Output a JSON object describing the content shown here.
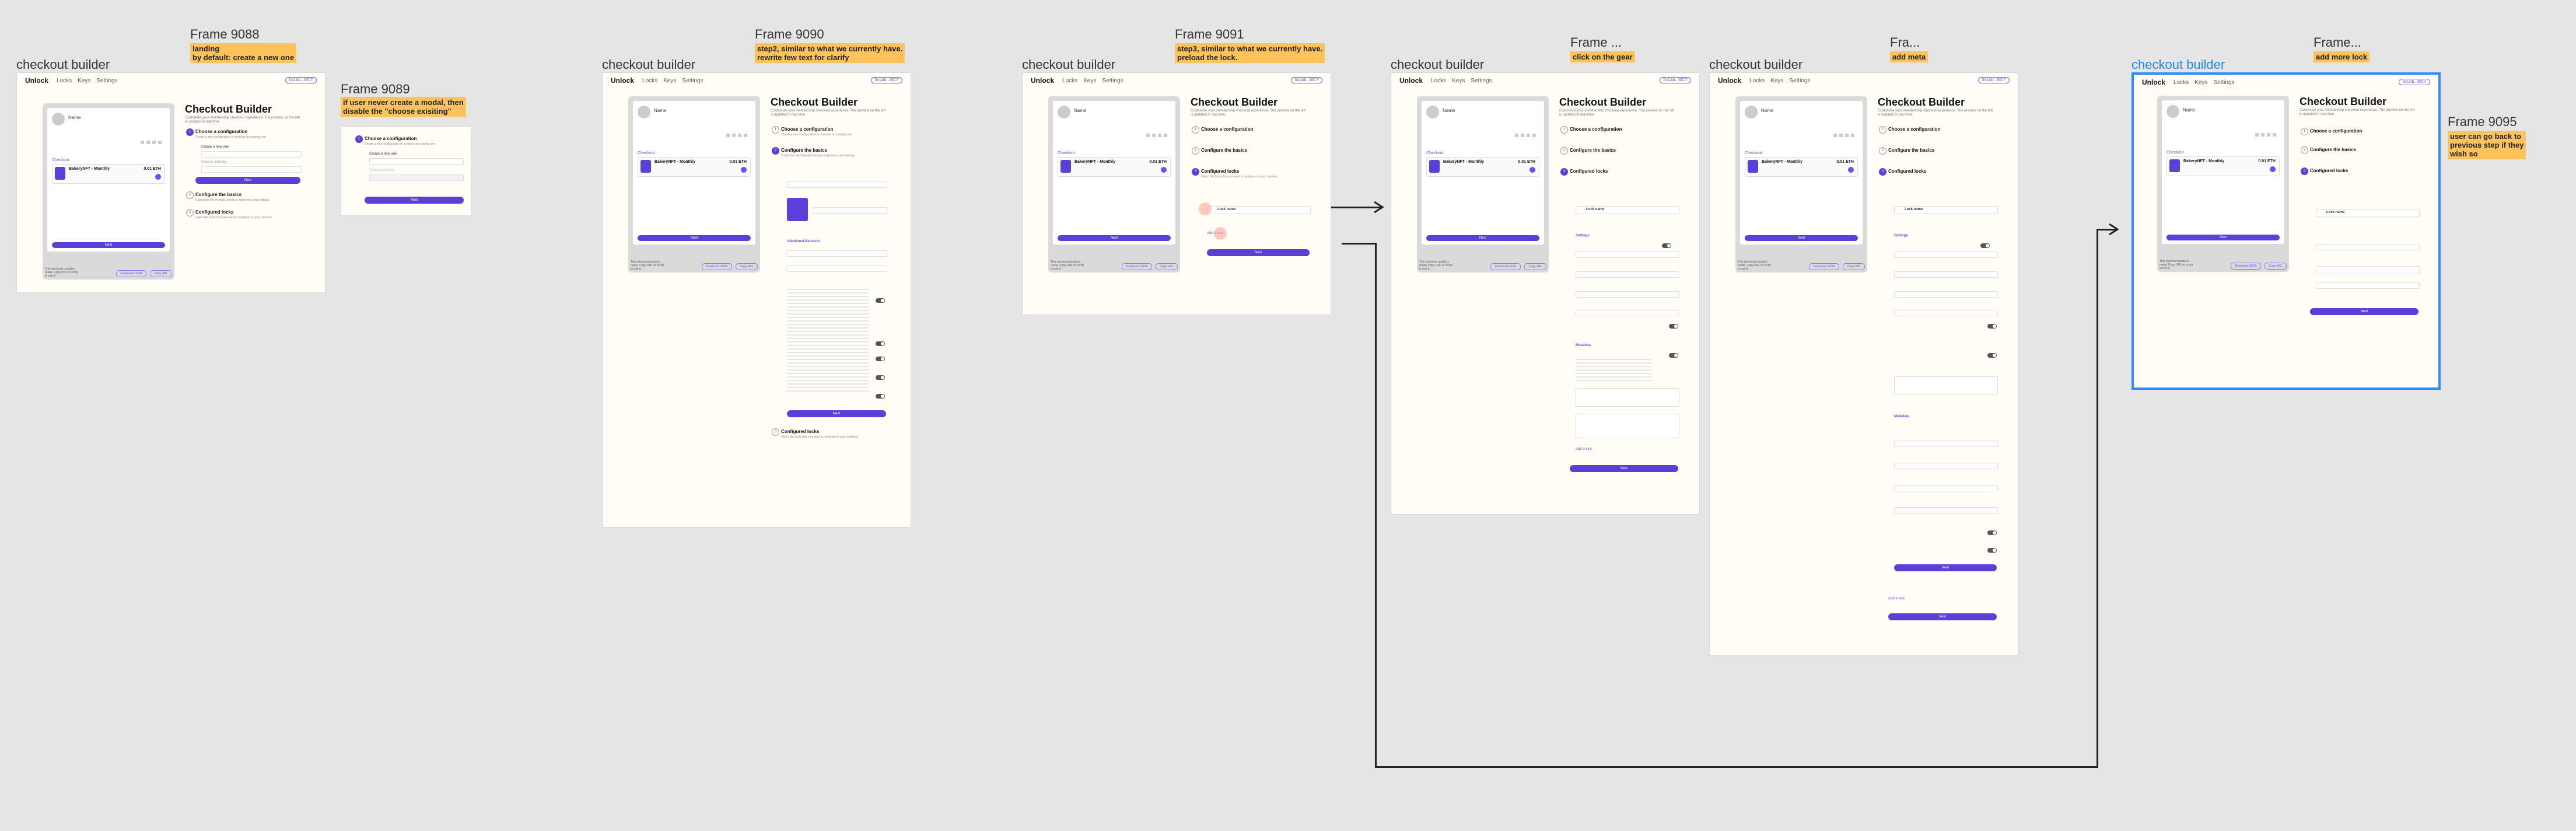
{
  "frames": [
    {
      "section": "checkout builder",
      "name": "Frame 9088",
      "note": "landing\nby default: create a new one"
    },
    {
      "section": "",
      "name": "Frame 9089",
      "note": "if user never create a modal, then\ndisable the \"choose exisiting\""
    },
    {
      "section": "checkout builder",
      "name": "Frame 9090",
      "note": "step2, similar to what we currently have.\nrewrite few text for clarify"
    },
    {
      "section": "checkout builder",
      "name": "Frame 9091",
      "note": "step3, similar to what we currently have.\npreload the lock."
    },
    {
      "section": "checkout builder",
      "name": "Frame ...",
      "note": "click on the gear"
    },
    {
      "section": "checkout builder",
      "name": "Fra...",
      "note": "add meta"
    },
    {
      "section": "checkout builder",
      "name": "Frame...",
      "note": "add more lock"
    },
    {
      "section": "",
      "name": "Frame 9095",
      "note": "user can go back to\nprevious step if they\nwish so"
    }
  ],
  "app": {
    "logo": "Unlock",
    "nav": [
      "Locks",
      "Keys",
      "Settings"
    ],
    "wallet": "0x1Ab...6fC7",
    "builder_title": "Checkout Builder",
    "builder_subtitle": "Customize your membership checkout experience. The preview on the left is updated in real-time.",
    "steps": [
      "Choose a configuration",
      "Configure the basics",
      "Configured locks"
    ],
    "step_desc": [
      "Create a new configuration or continue an existing one.",
      "Customize the Paywall checkout experience and settings.",
      "Select the locks that you want to configure in your checkout."
    ],
    "next_label": "Next",
    "additional_label": "Additional Behavior",
    "settings_label": "Settings",
    "metadata_label": "Metadata",
    "add_lock_label": "Add a lock",
    "lock_name": "Lock name",
    "config_new": "Create a new one",
    "config_existing": "Choose existing",
    "config_placeholder": "Configuration name"
  },
  "preview": {
    "name": "Name",
    "section": "Checkout",
    "lock_title": "BakeryNFT - Monthly",
    "lock_price": "0.01 ETH",
    "button": "Next",
    "footer": "This checkout modal is ready. Copy URL or script to use it.",
    "footer_btn1": "Download JSON",
    "footer_btn2": "Copy URL"
  }
}
